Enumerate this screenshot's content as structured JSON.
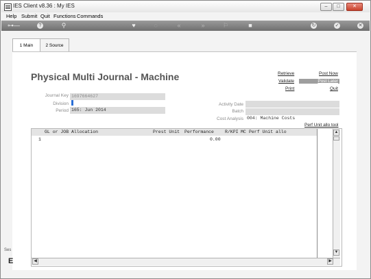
{
  "window": {
    "title": "IES Client v8.36 : My IES"
  },
  "menu": [
    "Help",
    "Submit",
    "Quit",
    "Functions",
    "Commands"
  ],
  "tabs": [
    {
      "label": "1 Main"
    },
    {
      "label": "2 Source"
    }
  ],
  "form": {
    "title": "Physical Multi Journal - Machine"
  },
  "actions": {
    "retrieve": "Retrieve",
    "validate": "Validate",
    "print": "Print",
    "post_now": "Post Now",
    "post_later": "Post Later",
    "quit": "Quit"
  },
  "fields": {
    "journal_key": {
      "label": "Journal Key",
      "value": "1697664627"
    },
    "division": {
      "label": "Division",
      "value": ""
    },
    "period": {
      "label": "Period",
      "value": "165: Jun 2014"
    },
    "activity_date": {
      "label": "Activity Date",
      "value": ""
    },
    "batch": {
      "label": "Batch",
      "value": ""
    },
    "cost_analysis": {
      "label": "Cost Analysis",
      "value": "004: Machine Costs"
    }
  },
  "perf_unit_tool": "Perf Unit allo tool",
  "grid": {
    "headers": [
      "GL or JOB Allocation",
      "Prest Unit",
      "Performance",
      "R/KPI",
      "MC",
      "Perf Unit allo"
    ],
    "rows": [
      {
        "num": "1",
        "performance": "0.00"
      }
    ]
  },
  "left_strip": {
    "text": "Ses",
    "glyph": "E"
  },
  "colors": {
    "toolbar": "#7f7f7f",
    "highlight": "#9e9e9e",
    "division_indicator": "#2a6fd6"
  }
}
